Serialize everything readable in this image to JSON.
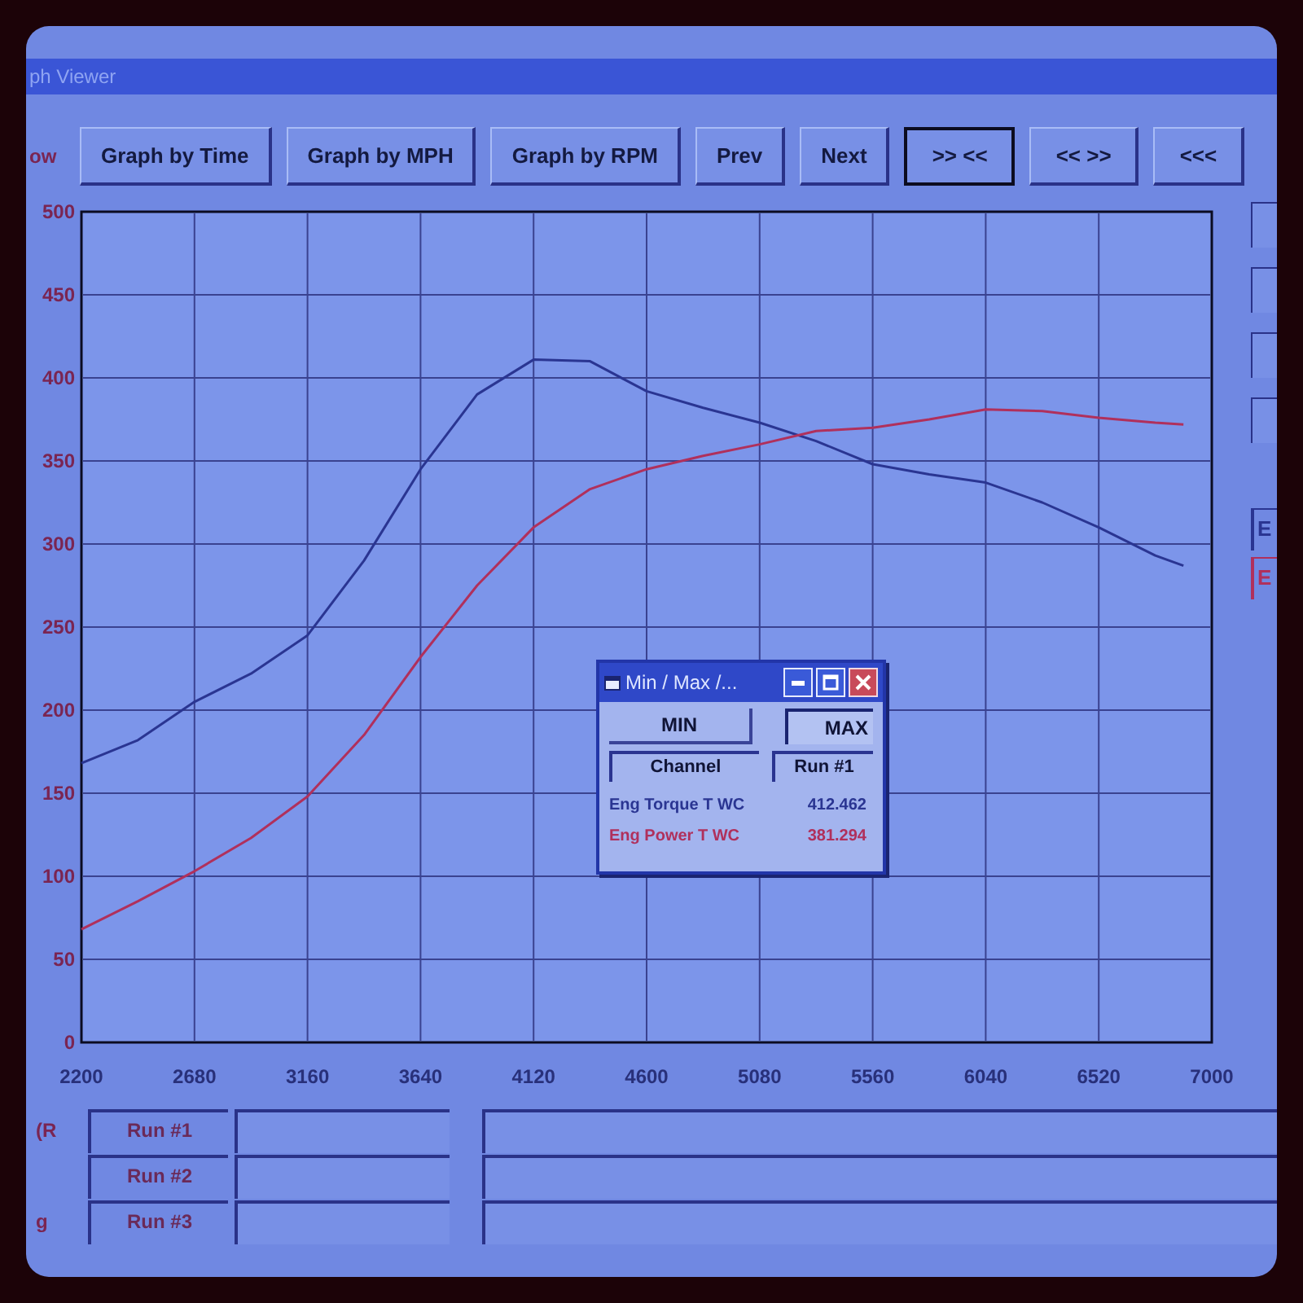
{
  "window": {
    "title": "ph Viewer"
  },
  "toolbar": {
    "buttons": [
      {
        "label": "Graph by Time",
        "selected": false
      },
      {
        "label": "Graph by MPH",
        "selected": false
      },
      {
        "label": "Graph by RPM",
        "selected": false
      },
      {
        "label": "Prev",
        "selected": false
      },
      {
        "label": "Next",
        "selected": false
      },
      {
        "label": ">> <<",
        "selected": true
      },
      {
        "label": "<< >>",
        "selected": false
      },
      {
        "label": "<<<",
        "selected": false
      }
    ]
  },
  "graph": {
    "chart_data": {
      "type": "line",
      "ylabel": "ow",
      "grid": true,
      "x": [
        2200,
        2440,
        2680,
        2920,
        3160,
        3400,
        3640,
        3880,
        4120,
        4360,
        4600,
        4840,
        5080,
        5320,
        5560,
        5800,
        6040,
        6280,
        6520,
        6760,
        6880
      ],
      "series": [
        {
          "name": "E",
          "color": "#2a3592",
          "values": [
            168,
            182,
            205,
            222,
            245,
            290,
            345,
            390,
            411,
            410,
            392,
            382,
            373,
            362,
            348,
            342,
            337,
            325,
            310,
            293,
            287
          ]
        },
        {
          "name": "E",
          "color": "#b0305c",
          "values": [
            68,
            85,
            103,
            123,
            148,
            185,
            232,
            275,
            310,
            333,
            345,
            353,
            360,
            368,
            370,
            375,
            381,
            380,
            376,
            373,
            372
          ]
        }
      ],
      "xlim": [
        2200,
        7000
      ],
      "ylim": [
        0,
        500
      ],
      "xticks": [
        2200,
        2680,
        3160,
        3640,
        4120,
        4600,
        5080,
        5560,
        6040,
        6520,
        7000
      ],
      "yticks": [
        0,
        50,
        100,
        150,
        200,
        250,
        300,
        350,
        400,
        450,
        500
      ]
    }
  },
  "min_max_window": {
    "title": "Min / Max /...",
    "tabs": [
      {
        "label": "MIN",
        "selected": false
      },
      {
        "label": "MAX",
        "selected": true
      }
    ],
    "columns": [
      "Channel",
      "Run #1"
    ],
    "rows": [
      {
        "channel": "Eng Torque T WC",
        "value": "412.462",
        "color": "#2a3592"
      },
      {
        "channel": "Eng Power T WC",
        "value": "381.294",
        "color": "#b0305c"
      }
    ]
  },
  "runs": [
    {
      "side_label": "(R",
      "label": "Run #1"
    },
    {
      "label": "Run #2"
    },
    {
      "side_label": "g",
      "label": "Run #3"
    }
  ]
}
